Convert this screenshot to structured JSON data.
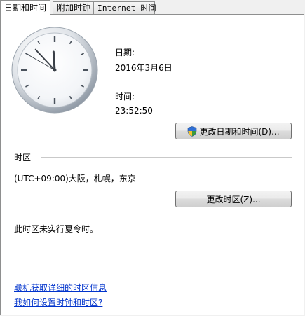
{
  "tabs": [
    {
      "label": "日期和时间",
      "active": true
    },
    {
      "label": "附加时钟",
      "active": false
    },
    {
      "label": "Internet 时间",
      "active": false
    }
  ],
  "datetime": {
    "date_label": "日期:",
    "date_value": "2016年3月6日",
    "time_label": "时间:",
    "time_value": "23:52:50",
    "change_button_label": "更改日期和时间(D)...",
    "change_button_mnemonic": "D"
  },
  "timezone": {
    "section_title": "时区",
    "value": "(UTC+09:00)大阪，札幌，东京",
    "change_button_label": "更改时区(Z)...",
    "change_button_mnemonic": "Z",
    "dst_note": "此时区未实行夏令时。"
  },
  "links": {
    "online_info": "联机获取详细的时区信息",
    "how_to_set": "我如何设置时钟和时区?"
  },
  "clock": {
    "hour": 23,
    "minute": 52,
    "second": 50
  },
  "colors": {
    "link": "#0033cc",
    "panel_bg": "#ffffff",
    "window_bg": "#f0f0f0"
  }
}
